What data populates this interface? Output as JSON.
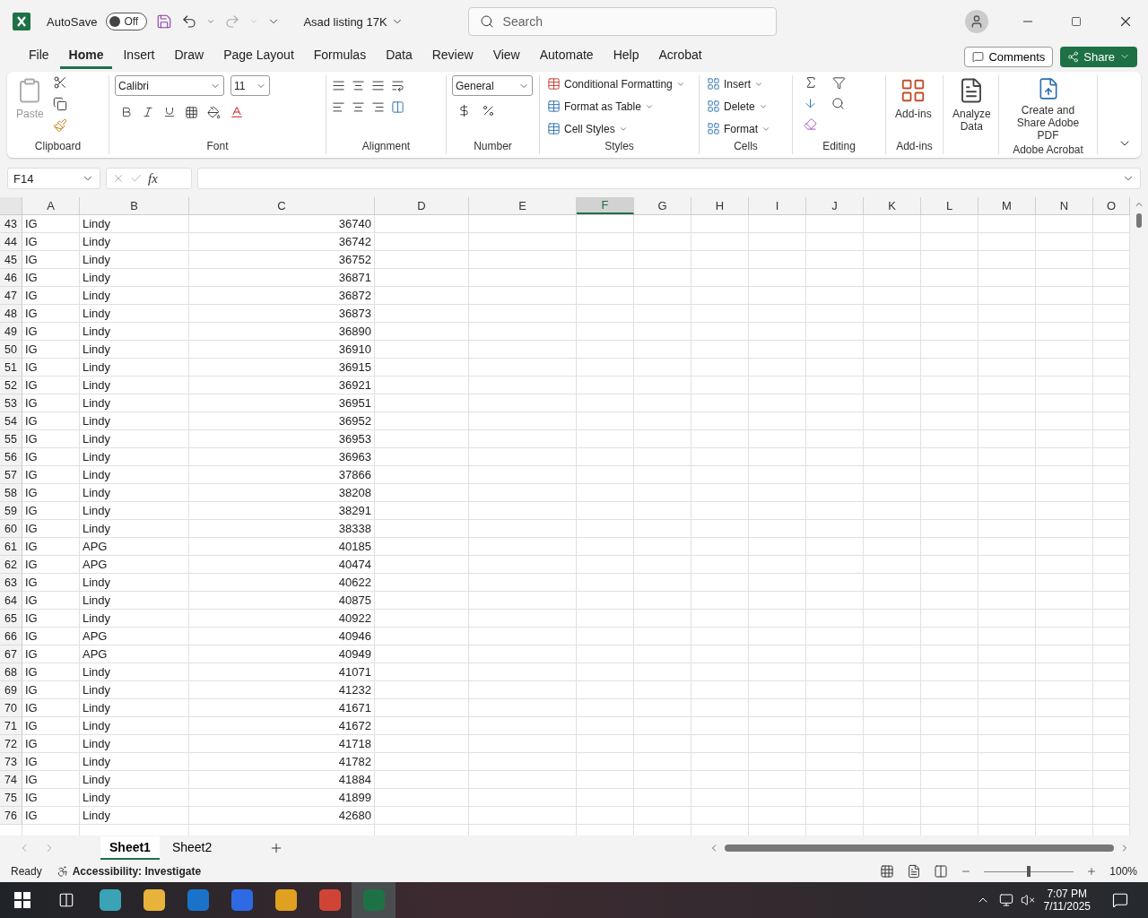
{
  "title_bar": {
    "autosave_label": "AutoSave",
    "autosave_state": "Off",
    "autosave_on": false,
    "filename": "Asad listing 17K",
    "search_placeholder": "Search"
  },
  "menu_tabs": [
    {
      "label": "File",
      "selected": false
    },
    {
      "label": "Home",
      "selected": true
    },
    {
      "label": "Insert",
      "selected": false
    },
    {
      "label": "Draw",
      "selected": false
    },
    {
      "label": "Page Layout",
      "selected": false
    },
    {
      "label": "Formulas",
      "selected": false
    },
    {
      "label": "Data",
      "selected": false
    },
    {
      "label": "Review",
      "selected": false
    },
    {
      "label": "View",
      "selected": false
    },
    {
      "label": "Automate",
      "selected": false
    },
    {
      "label": "Help",
      "selected": false
    },
    {
      "label": "Acrobat",
      "selected": false
    }
  ],
  "comments_button": "Comments",
  "share_button": "Share",
  "ribbon": {
    "clipboard": {
      "paste": "Paste",
      "label": "Clipboard"
    },
    "font": {
      "font_name": "Calibri",
      "font_size": "11",
      "label": "Font"
    },
    "alignment": {
      "label": "Alignment"
    },
    "number": {
      "format": "General",
      "label": "Number"
    },
    "styles": {
      "items": [
        "Conditional Formatting",
        "Format as Table",
        "Cell Styles"
      ],
      "label": "Styles"
    },
    "cells": {
      "items": [
        "Insert",
        "Delete",
        "Format"
      ],
      "label": "Cells"
    },
    "editing": {
      "label": "Editing"
    },
    "addins": {
      "button": "Add-ins",
      "label": "Add-ins"
    },
    "analyze": {
      "button": "Analyze Data"
    },
    "acrobat": {
      "button": "Create and Share Adobe PDF",
      "label": "Adobe Acrobat"
    }
  },
  "formula_bar": {
    "name_box": "F14",
    "fx_label": "fx"
  },
  "grid": {
    "columns": [
      {
        "label": "A",
        "selected": false
      },
      {
        "label": "B",
        "selected": false
      },
      {
        "label": "C",
        "selected": false
      },
      {
        "label": "D",
        "selected": false
      },
      {
        "label": "E",
        "selected": false
      },
      {
        "label": "F",
        "selected": true
      },
      {
        "label": "G",
        "selected": false
      },
      {
        "label": "H",
        "selected": false
      },
      {
        "label": "I",
        "selected": false
      },
      {
        "label": "J",
        "selected": false
      },
      {
        "label": "K",
        "selected": false
      },
      {
        "label": "L",
        "selected": false
      },
      {
        "label": "M",
        "selected": false
      },
      {
        "label": "N",
        "selected": false
      },
      {
        "label": "O",
        "selected": false
      }
    ],
    "rows": [
      {
        "number": "43",
        "cells": [
          "IG",
          "Lindy",
          "36740"
        ]
      },
      {
        "number": "44",
        "cells": [
          "IG",
          "Lindy",
          "36742"
        ]
      },
      {
        "number": "45",
        "cells": [
          "IG",
          "Lindy",
          "36752"
        ]
      },
      {
        "number": "46",
        "cells": [
          "IG",
          "Lindy",
          "36871"
        ]
      },
      {
        "number": "47",
        "cells": [
          "IG",
          "Lindy",
          "36872"
        ]
      },
      {
        "number": "48",
        "cells": [
          "IG",
          "Lindy",
          "36873"
        ]
      },
      {
        "number": "49",
        "cells": [
          "IG",
          "Lindy",
          "36890"
        ]
      },
      {
        "number": "50",
        "cells": [
          "IG",
          "Lindy",
          "36910"
        ]
      },
      {
        "number": "51",
        "cells": [
          "IG",
          "Lindy",
          "36915"
        ]
      },
      {
        "number": "52",
        "cells": [
          "IG",
          "Lindy",
          "36921"
        ]
      },
      {
        "number": "53",
        "cells": [
          "IG",
          "Lindy",
          "36951"
        ]
      },
      {
        "number": "54",
        "cells": [
          "IG",
          "Lindy",
          "36952"
        ]
      },
      {
        "number": "55",
        "cells": [
          "IG",
          "Lindy",
          "36953"
        ]
      },
      {
        "number": "56",
        "cells": [
          "IG",
          "Lindy",
          "36963"
        ]
      },
      {
        "number": "57",
        "cells": [
          "IG",
          "Lindy",
          "37866"
        ]
      },
      {
        "number": "58",
        "cells": [
          "IG",
          "Lindy",
          "38208"
        ]
      },
      {
        "number": "59",
        "cells": [
          "IG",
          "Lindy",
          "38291"
        ]
      },
      {
        "number": "60",
        "cells": [
          "IG",
          "Lindy",
          "38338"
        ]
      },
      {
        "number": "61",
        "cells": [
          "IG",
          "APG",
          "40185"
        ]
      },
      {
        "number": "62",
        "cells": [
          "IG",
          "APG",
          "40474"
        ]
      },
      {
        "number": "63",
        "cells": [
          "IG",
          "Lindy",
          "40622"
        ]
      },
      {
        "number": "64",
        "cells": [
          "IG",
          "Lindy",
          "40875"
        ]
      },
      {
        "number": "65",
        "cells": [
          "IG",
          "Lindy",
          "40922"
        ]
      },
      {
        "number": "66",
        "cells": [
          "IG",
          "APG",
          "40946"
        ]
      },
      {
        "number": "67",
        "cells": [
          "IG",
          "APG",
          "40949"
        ]
      },
      {
        "number": "68",
        "cells": [
          "IG",
          "Lindy",
          "41071"
        ]
      },
      {
        "number": "69",
        "cells": [
          "IG",
          "Lindy",
          "41232"
        ]
      },
      {
        "number": "70",
        "cells": [
          "IG",
          "Lindy",
          "41671"
        ]
      },
      {
        "number": "71",
        "cells": [
          "IG",
          "Lindy",
          "41672"
        ]
      },
      {
        "number": "72",
        "cells": [
          "IG",
          "Lindy",
          "41718"
        ]
      },
      {
        "number": "73",
        "cells": [
          "IG",
          "Lindy",
          "41782"
        ]
      },
      {
        "number": "74",
        "cells": [
          "IG",
          "Lindy",
          "41884"
        ]
      },
      {
        "number": "75",
        "cells": [
          "IG",
          "Lindy",
          "41899"
        ]
      },
      {
        "number": "76",
        "cells": [
          "IG",
          "Lindy",
          "42680"
        ]
      }
    ]
  },
  "sheet_tabs": [
    {
      "label": "Sheet1",
      "selected": true
    },
    {
      "label": "Sheet2",
      "selected": false
    }
  ],
  "status_bar": {
    "status": "Ready",
    "accessibility": "Accessibility: Investigate",
    "zoom_slider": {
      "level": 0.5
    },
    "zoom": "100%"
  },
  "taskbar": {
    "time": "7:07 PM",
    "date": "7/11/2025"
  }
}
